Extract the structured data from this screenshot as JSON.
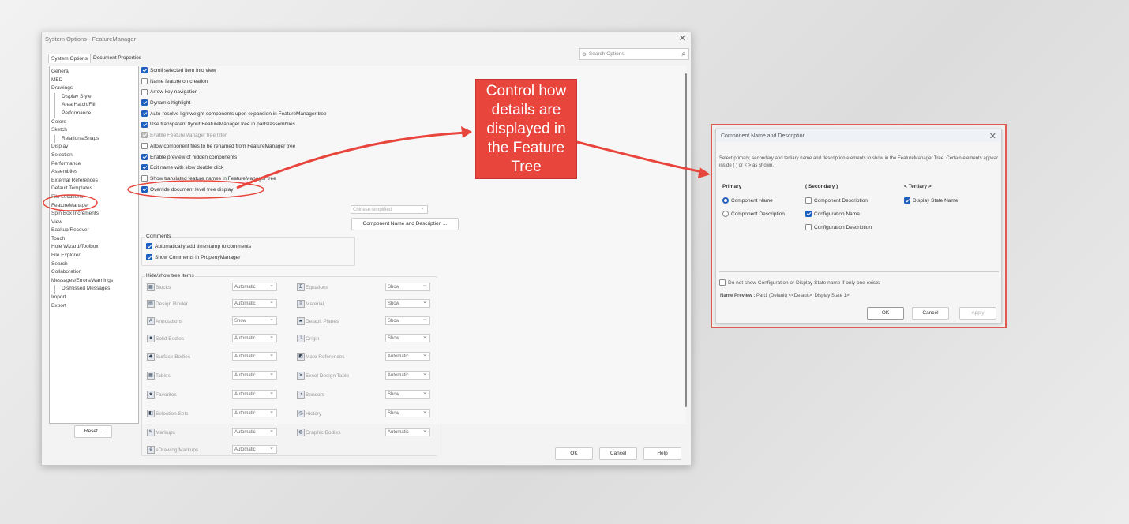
{
  "main_window": {
    "title": "System Options - FeatureManager",
    "tabs": [
      "System Options",
      "Document Properties"
    ],
    "search_placeholder": "Search Options",
    "tree": [
      {
        "label": "General",
        "sub": false
      },
      {
        "label": "MBD",
        "sub": false
      },
      {
        "label": "Drawings",
        "sub": false
      },
      {
        "label": "Display Style",
        "sub": true
      },
      {
        "label": "Area Hatch/Fill",
        "sub": true
      },
      {
        "label": "Performance",
        "sub": true
      },
      {
        "label": "Colors",
        "sub": false
      },
      {
        "label": "Sketch",
        "sub": false
      },
      {
        "label": "Relations/Snaps",
        "sub": true
      },
      {
        "label": "Display",
        "sub": false
      },
      {
        "label": "Selection",
        "sub": false
      },
      {
        "label": "Performance",
        "sub": false
      },
      {
        "label": "Assemblies",
        "sub": false
      },
      {
        "label": "External References",
        "sub": false
      },
      {
        "label": "Default Templates",
        "sub": false
      },
      {
        "label": "File Locations",
        "sub": false
      },
      {
        "label": "FeatureManager",
        "sub": false,
        "selected": true
      },
      {
        "label": "Spin Box Increments",
        "sub": false
      },
      {
        "label": "View",
        "sub": false
      },
      {
        "label": "Backup/Recover",
        "sub": false
      },
      {
        "label": "Touch",
        "sub": false
      },
      {
        "label": "Hole Wizard/Toolbox",
        "sub": false
      },
      {
        "label": "File Explorer",
        "sub": false
      },
      {
        "label": "Search",
        "sub": false
      },
      {
        "label": "Collaboration",
        "sub": false
      },
      {
        "label": "Messages/Errors/Warnings",
        "sub": false
      },
      {
        "label": "Dismissed Messages",
        "sub": true
      },
      {
        "label": "Import",
        "sub": false
      },
      {
        "label": "Export",
        "sub": false
      }
    ],
    "options": [
      {
        "label": "Scroll selected item into view",
        "checked": true
      },
      {
        "label": "Name feature on creation",
        "checked": false
      },
      {
        "label": "Arrow key navigation",
        "checked": false
      },
      {
        "label": "Dynamic highlight",
        "checked": true
      },
      {
        "label": "Auto-resolve lightweight components upon expansion in FeatureManager tree",
        "checked": true
      },
      {
        "label": "Use transparent flyout FeatureManager tree in parts/assemblies",
        "checked": true
      },
      {
        "label": "Enable FeatureManager tree filter",
        "checked": true,
        "disabled": true
      },
      {
        "label": "Allow component files to be renamed from FeatureManager tree",
        "checked": false
      },
      {
        "label": "Enable preview of hidden components",
        "checked": true
      },
      {
        "label": "Edit name with slow double click",
        "checked": true
      },
      {
        "label": "Show translated feature names in FeatureManager tree",
        "checked": false
      },
      {
        "label": "Override document level tree display",
        "checked": true
      }
    ],
    "language_select": "Chinese-simplified",
    "component_name_button": "Component Name and Description ...",
    "comments": {
      "title": "Comments",
      "items": [
        {
          "label": "Automatically add timestamp to comments",
          "checked": true
        },
        {
          "label": "Show Comments in PropertyManager",
          "checked": true
        }
      ]
    },
    "hide_show": {
      "title": "Hide/show tree items",
      "left": [
        [
          "Blocks",
          "Automatic"
        ],
        [
          "Design Binder",
          "Automatic"
        ],
        [
          "Annotations",
          "Show"
        ],
        [
          "Solid Bodies",
          "Automatic"
        ],
        [
          "Surface Bodies",
          "Automatic"
        ],
        [
          "Tables",
          "Automatic"
        ],
        [
          "Favorites",
          "Automatic"
        ],
        [
          "Selection Sets",
          "Automatic"
        ],
        [
          "Markups",
          "Automatic"
        ],
        [
          "eDrawing Markups",
          "Automatic"
        ]
      ],
      "right": [
        [
          "Equations",
          "Show"
        ],
        [
          "Material",
          "Show"
        ],
        [
          "Default Planes",
          "Show"
        ],
        [
          "Origin",
          "Show"
        ],
        [
          "Mate References",
          "Automatic"
        ],
        [
          "Excel Design Table",
          "Automatic"
        ],
        [
          "Sensors",
          "Show"
        ],
        [
          "History",
          "Show"
        ],
        [
          "Graphic Bodies",
          "Automatic"
        ]
      ]
    },
    "reset": "Reset...",
    "ok": "OK",
    "cancel": "Cancel",
    "help": "Help"
  },
  "callout": {
    "text": "Control how details are displayed in the Feature Tree",
    "color": "#e8453c"
  },
  "dialog": {
    "title": "Component Name and Description",
    "description": "Select primary, secondary and tertiary name and description elements to show in the FeatureManager Tree. Certain elements appear inside ( ) or < > as shown.",
    "primary": {
      "title": "Primary",
      "options": [
        {
          "label": "Component Name",
          "selected": true
        },
        {
          "label": "Component Description",
          "selected": false
        }
      ]
    },
    "secondary": {
      "title": "( Secondary )",
      "options": [
        {
          "label": "Component Description",
          "checked": false
        },
        {
          "label": "Configuration Name",
          "checked": true
        },
        {
          "label": "Configuration Description",
          "checked": false
        }
      ]
    },
    "tertiary": {
      "title": "< Tertiary >",
      "options": [
        {
          "label": "Display State Name",
          "checked": true
        }
      ]
    },
    "hide_single": "Do not show Configuration or Display State name if only one exists",
    "preview_label": "Name Preview :",
    "preview_value": "Part1 (Default) <<Default>_Display State 1>",
    "ok": "OK",
    "cancel": "Cancel",
    "apply": "Apply"
  }
}
